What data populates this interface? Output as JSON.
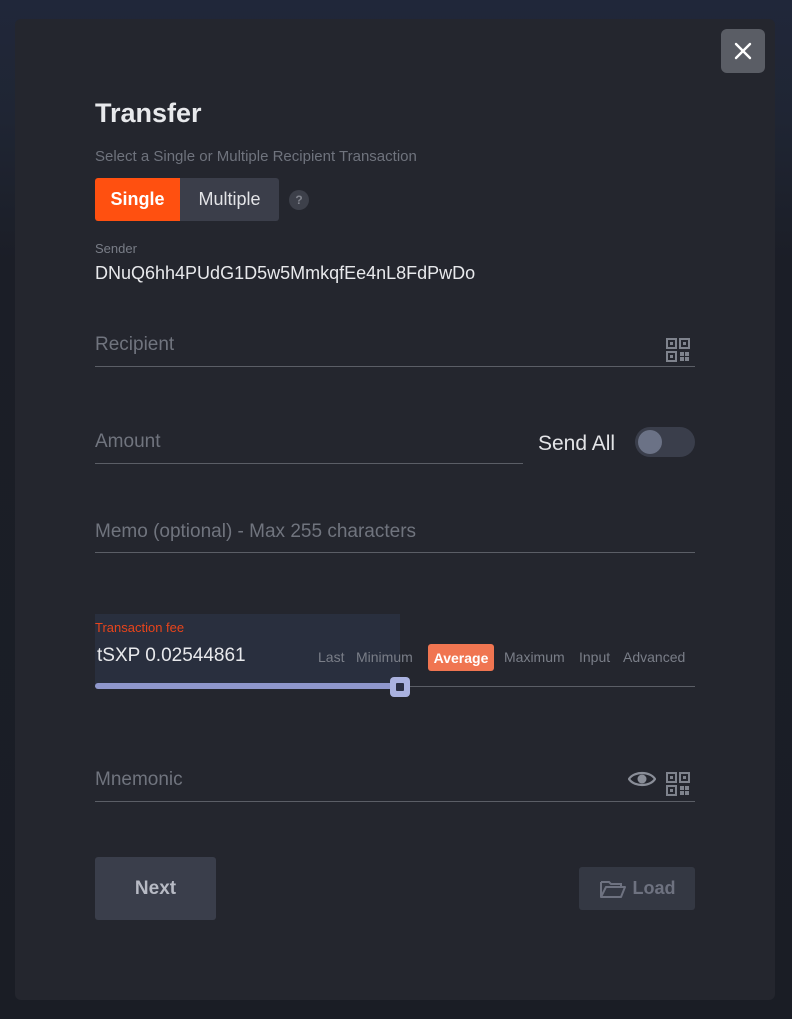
{
  "modal": {
    "title": "Transfer",
    "subtitle": "Select a Single or Multiple Recipient Transaction",
    "close_icon": "close-icon"
  },
  "mode": {
    "single_label": "Single",
    "multiple_label": "Multiple",
    "selected": "Single",
    "help_label": "?"
  },
  "sender": {
    "label": "Sender",
    "value": "DNuQ6hh4PUdG1D5w5MmkqfEe4nL8FdPwDo"
  },
  "recipient": {
    "placeholder": "Recipient",
    "icon": "qr-code-icon"
  },
  "amount": {
    "placeholder": "Amount",
    "send_all_label": "Send All",
    "send_all_on": false
  },
  "memo": {
    "placeholder": "Memo (optional) - Max 255 characters"
  },
  "fee": {
    "label": "Transaction fee",
    "value": "tSXP 0.02544861",
    "options": [
      "Last",
      "Minimum",
      "Average",
      "Maximum",
      "Input",
      "Advanced"
    ],
    "selected": "Average",
    "slider_level": 0.5,
    "label_color": "#e8441b",
    "active_color": "#f07551"
  },
  "mnemonic": {
    "placeholder": "Mnemonic",
    "icons": [
      "eye-icon",
      "qr-code-icon"
    ]
  },
  "actions": {
    "next_label": "Next",
    "load_label": "Load",
    "load_icon": "folder-open-icon"
  },
  "colors": {
    "accent": "#ff5010",
    "background": "#24262e"
  }
}
